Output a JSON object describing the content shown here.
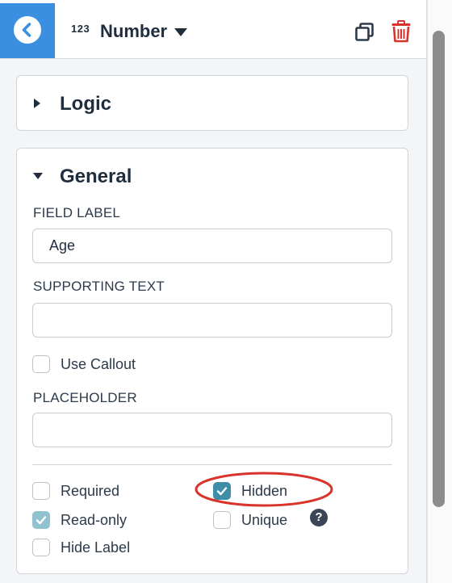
{
  "header": {
    "back_icon": "chevron-left-icon",
    "type_icon_text": "123",
    "type_label": "Number",
    "type_dropdown_icon": "caret-down-icon",
    "copy_icon": "duplicate-icon",
    "delete_icon": "trash-icon",
    "accent_color": "#3b8fe0",
    "delete_color": "#d9342b"
  },
  "logic_section": {
    "title": "Logic",
    "expanded": false
  },
  "general_section": {
    "title": "General",
    "expanded": true,
    "field_label": {
      "label": "FIELD LABEL",
      "value": "Age"
    },
    "supporting_text": {
      "label": "SUPPORTING TEXT",
      "value": ""
    },
    "use_callout": {
      "label": "Use Callout",
      "checked": false
    },
    "placeholder": {
      "label": "PLACEHOLDER",
      "value": ""
    },
    "options": {
      "required": {
        "label": "Required",
        "checked": false
      },
      "hidden": {
        "label": "Hidden",
        "checked": true
      },
      "read_only": {
        "label": "Read-only",
        "checked": true,
        "disabled": true
      },
      "unique": {
        "label": "Unique",
        "checked": false
      },
      "hide_label": {
        "label": "Hide Label",
        "checked": false
      },
      "help_icon_text": "?"
    },
    "check_color": "#3d8ea6",
    "highlight_color": "#d9342b"
  }
}
